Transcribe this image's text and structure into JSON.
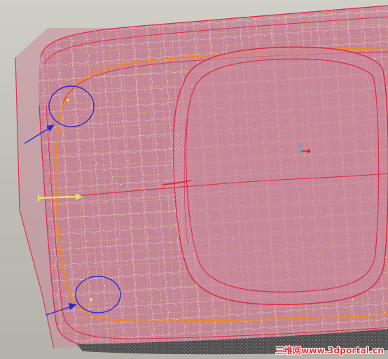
{
  "viewport": {
    "background_color": "#bdbdb3",
    "plane_color": "#c98a9c",
    "surface_edge_color": "#e0284a",
    "trim_curve_color": "#f08a1a",
    "mesh_color_white": "#f4f4f4",
    "mesh_color_yellow": "#e8d070",
    "highlight_circle_color": "#2a2ad8",
    "pointer_arrow_color": "#2a2ad8"
  },
  "callouts": [
    {
      "name": "upper-left-corner",
      "icon": "arrow-icon"
    },
    {
      "name": "lower-left-corner",
      "icon": "arrow-icon"
    }
  ],
  "triad": {
    "icon": "coordinate-triad-icon",
    "x_color": "#e02020",
    "y_color": "#20c0e0"
  },
  "direction_arrow": {
    "icon": "direction-arrow-icon",
    "color": "#f0e060"
  },
  "watermark": {
    "text": "三维网www.3dportal.cn"
  }
}
